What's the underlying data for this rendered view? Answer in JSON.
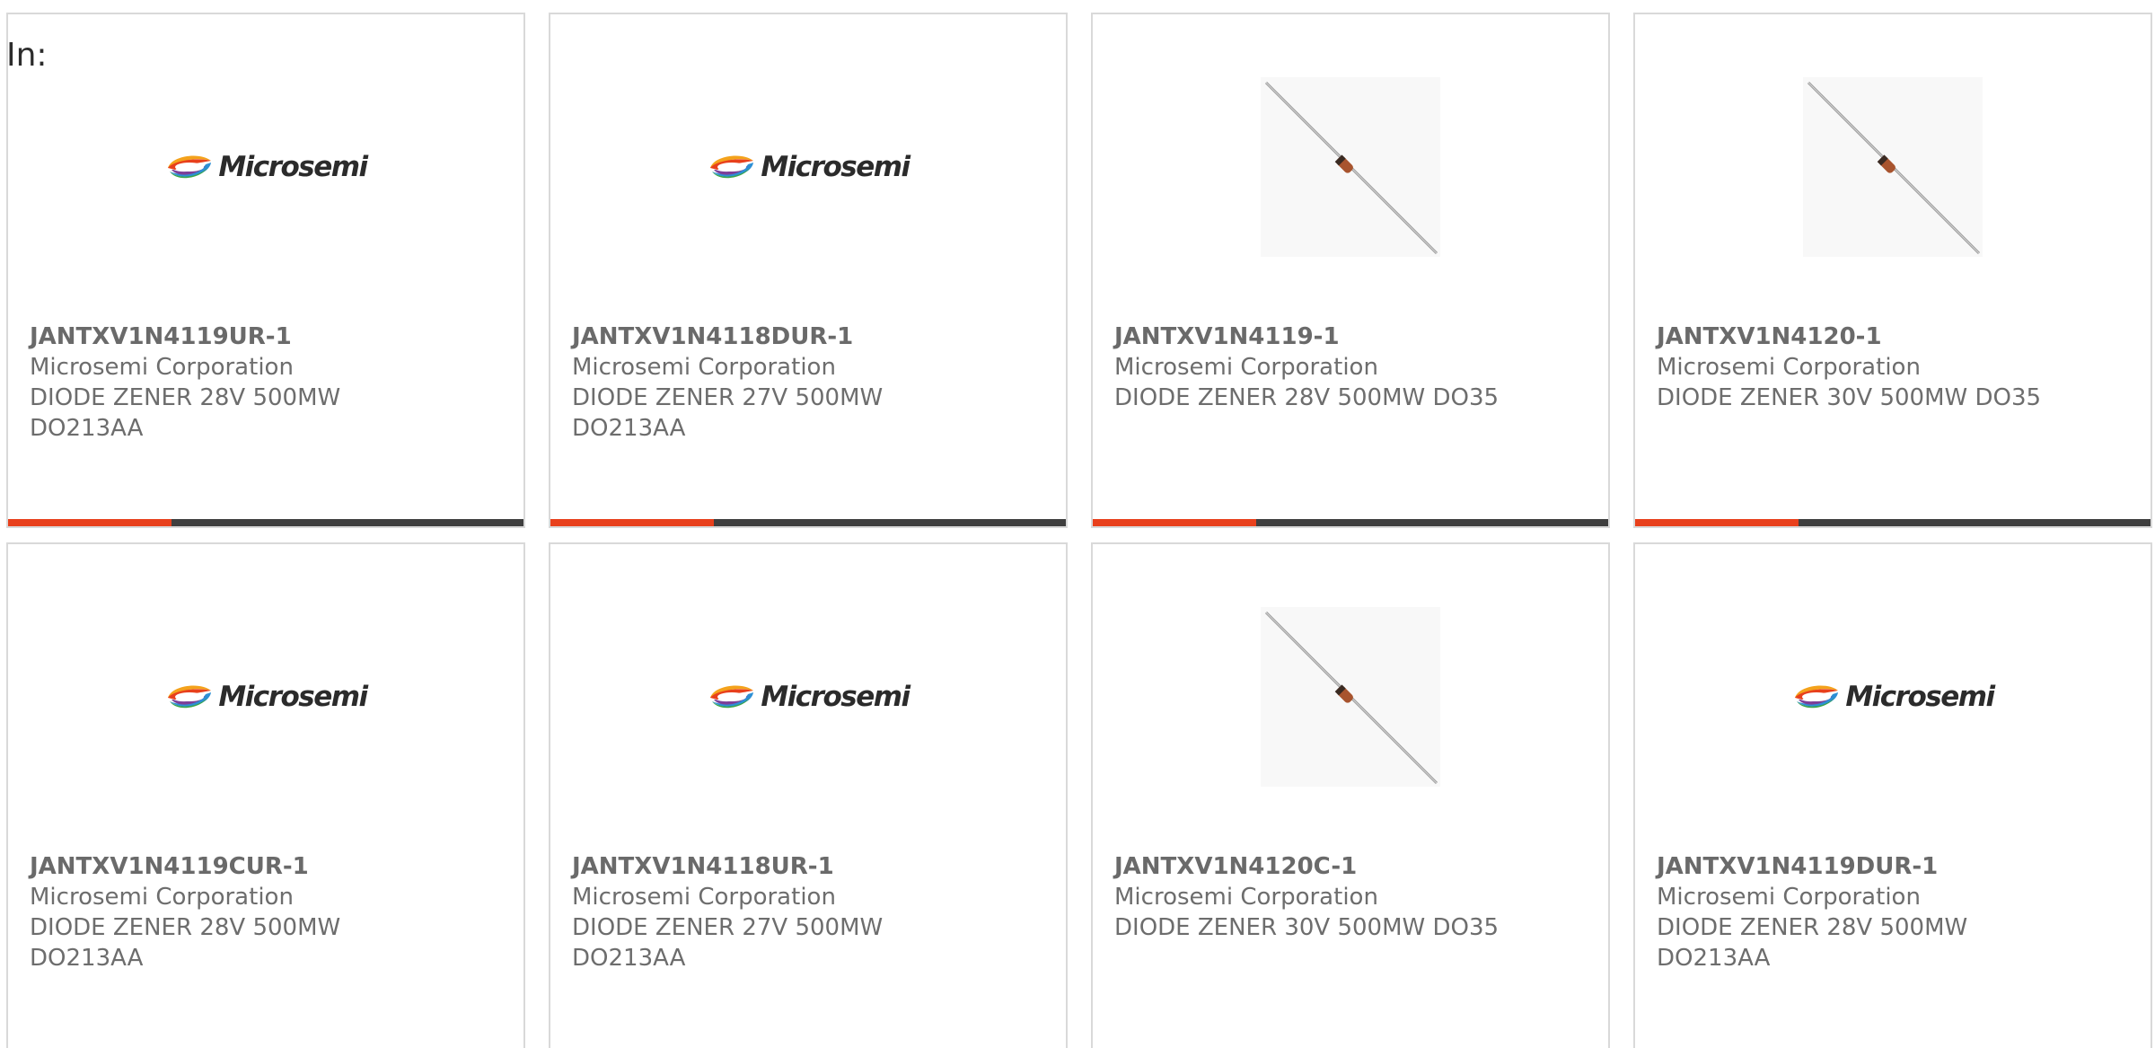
{
  "page": {
    "prefix_label": "In:"
  },
  "colors": {
    "accent": "#e8401c",
    "bar_dark": "#3f3f3f",
    "card_border": "#d9d9d9",
    "text_gray": "#6d6d6d"
  },
  "products": [
    {
      "part_number": "JANTXV1N4119UR-1",
      "manufacturer": "Microsemi Corporation",
      "description_line1": "DIODE ZENER 28V 500MW",
      "description_line2": "DO213AA",
      "image": "microsemi-logo",
      "logo_text": "Microsemi"
    },
    {
      "part_number": "JANTXV1N4118DUR-1",
      "manufacturer": "Microsemi Corporation",
      "description_line1": "DIODE ZENER 27V 500MW",
      "description_line2": "DO213AA",
      "image": "microsemi-logo",
      "logo_text": "Microsemi"
    },
    {
      "part_number": "JANTXV1N4119-1",
      "manufacturer": "Microsemi Corporation",
      "description_line1": "DIODE ZENER 28V 500MW DO35",
      "description_line2": "",
      "image": "axial-diode-photo"
    },
    {
      "part_number": "JANTXV1N4120-1",
      "manufacturer": "Microsemi Corporation",
      "description_line1": "DIODE ZENER 30V 500MW DO35",
      "description_line2": "",
      "image": "axial-diode-photo"
    },
    {
      "part_number": "JANTXV1N4119CUR-1",
      "manufacturer": "Microsemi Corporation",
      "description_line1": "DIODE ZENER 28V 500MW",
      "description_line2": "DO213AA",
      "image": "microsemi-logo",
      "logo_text": "Microsemi"
    },
    {
      "part_number": "JANTXV1N4118UR-1",
      "manufacturer": "Microsemi Corporation",
      "description_line1": "DIODE ZENER 27V 500MW",
      "description_line2": "DO213AA",
      "image": "microsemi-logo",
      "logo_text": "Microsemi"
    },
    {
      "part_number": "JANTXV1N4120C-1",
      "manufacturer": "Microsemi Corporation",
      "description_line1": "DIODE ZENER 30V 500MW DO35",
      "description_line2": "",
      "image": "axial-diode-photo"
    },
    {
      "part_number": "JANTXV1N4119DUR-1",
      "manufacturer": "Microsemi Corporation",
      "description_line1": "DIODE ZENER 28V 500MW",
      "description_line2": "DO213AA",
      "image": "microsemi-logo",
      "logo_text": "Microsemi"
    }
  ]
}
